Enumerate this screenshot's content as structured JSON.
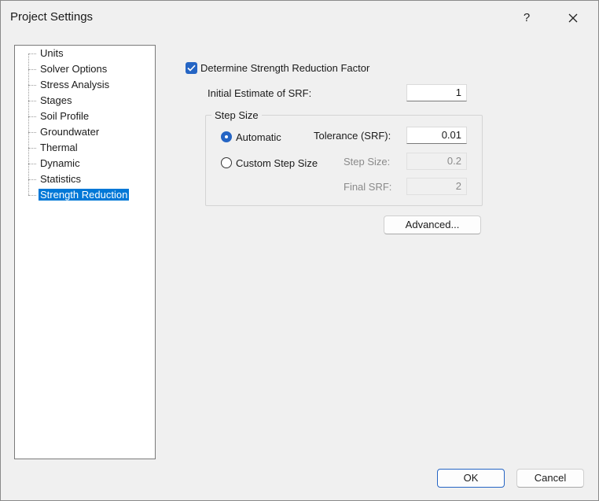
{
  "window": {
    "title": "Project Settings",
    "help_label": "?",
    "close_icon": "close-icon"
  },
  "tree": {
    "items": [
      {
        "label": "Units",
        "selected": false
      },
      {
        "label": "Solver Options",
        "selected": false
      },
      {
        "label": "Stress Analysis",
        "selected": false
      },
      {
        "label": "Stages",
        "selected": false
      },
      {
        "label": "Soil Profile",
        "selected": false
      },
      {
        "label": "Groundwater",
        "selected": false
      },
      {
        "label": "Thermal",
        "selected": false
      },
      {
        "label": "Dynamic",
        "selected": false
      },
      {
        "label": "Statistics",
        "selected": false
      },
      {
        "label": "Strength Reduction",
        "selected": true
      }
    ]
  },
  "srf": {
    "determine_label": "Determine Strength Reduction Factor",
    "determine_checked": true,
    "initial_label": "Initial Estimate of SRF:",
    "initial_value": "1"
  },
  "step_size": {
    "group_title": "Step Size",
    "automatic_label": "Automatic",
    "automatic_selected": true,
    "custom_label": "Custom Step Size",
    "custom_selected": false,
    "tolerance_label": "Tolerance (SRF):",
    "tolerance_value": "0.01",
    "step_size_label": "Step Size:",
    "step_size_value": "0.2",
    "final_srf_label": "Final SRF:",
    "final_srf_value": "2"
  },
  "buttons": {
    "advanced": "Advanced...",
    "ok": "OK",
    "cancel": "Cancel"
  },
  "colors": {
    "accent": "#2565c4",
    "selection": "#0078d7",
    "dialog_bg": "#f0f0f0"
  }
}
